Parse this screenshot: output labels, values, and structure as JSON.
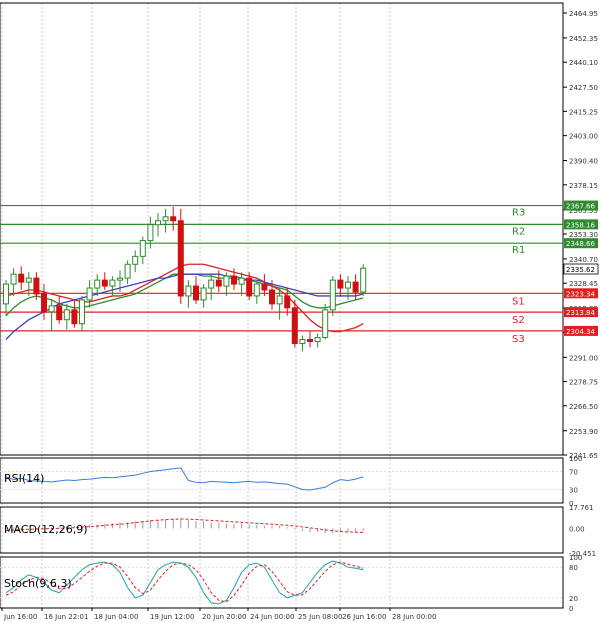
{
  "chart_data": [
    {
      "type": "candlestick",
      "pane": "price",
      "ylim": [
        2241.65,
        2470
      ],
      "y_ticks": [
        "2464.95",
        "2452.35",
        "2440.10",
        "2427.50",
        "2415.25",
        "2403.00",
        "2390.40",
        "2378.15",
        "2365.55",
        "2353.30",
        "2340.70",
        "2328.45",
        "2315.85",
        "2303.60",
        "2291.00",
        "2278.75",
        "2266.50",
        "2253.90",
        "2241.65"
      ],
      "x_ticks": [
        "Jun 16:00",
        "16 Jun 22:01",
        "18 Jun 04:00",
        "19 Jun 12:00",
        "20 Jun 20:00",
        "24 Jun 00:00",
        "25 Jun 08:00",
        "26 Jun 16:00",
        "28 Jun 00:00"
      ],
      "last_price": "2335.62",
      "candles": [
        [
          2318,
          2330,
          2312,
          2328
        ],
        [
          2328,
          2336,
          2322,
          2333
        ],
        [
          2333,
          2337,
          2325,
          2329
        ],
        [
          2329,
          2334,
          2322,
          2331
        ],
        [
          2331,
          2334,
          2320,
          2323
        ],
        [
          2323,
          2328,
          2310,
          2314
        ],
        [
          2314,
          2320,
          2304,
          2317
        ],
        [
          2317,
          2322,
          2308,
          2310
        ],
        [
          2310,
          2318,
          2305,
          2315
        ],
        [
          2315,
          2320,
          2306,
          2308
        ],
        [
          2308,
          2322,
          2304,
          2320
        ],
        [
          2320,
          2330,
          2316,
          2326
        ],
        [
          2326,
          2333,
          2322,
          2330
        ],
        [
          2330,
          2334,
          2325,
          2327
        ],
        [
          2327,
          2332,
          2322,
          2330
        ],
        [
          2330,
          2335,
          2324,
          2331
        ],
        [
          2331,
          2340,
          2328,
          2338
        ],
        [
          2338,
          2345,
          2334,
          2342
        ],
        [
          2342,
          2352,
          2338,
          2350
        ],
        [
          2350,
          2362,
          2346,
          2358
        ],
        [
          2358,
          2364,
          2352,
          2360
        ],
        [
          2360,
          2366,
          2354,
          2362
        ],
        [
          2362,
          2367,
          2355,
          2360
        ],
        [
          2360,
          2366,
          2318,
          2322
        ],
        [
          2322,
          2330,
          2316,
          2327
        ],
        [
          2327,
          2332,
          2318,
          2320
        ],
        [
          2320,
          2328,
          2316,
          2326
        ],
        [
          2326,
          2333,
          2320,
          2330
        ],
        [
          2330,
          2335,
          2324,
          2327
        ],
        [
          2327,
          2334,
          2322,
          2332
        ],
        [
          2332,
          2336,
          2325,
          2328
        ],
        [
          2328,
          2334,
          2322,
          2331
        ],
        [
          2331,
          2334,
          2320,
          2322
        ],
        [
          2322,
          2330,
          2318,
          2328
        ],
        [
          2328,
          2333,
          2322,
          2325
        ],
        [
          2325,
          2330,
          2315,
          2318
        ],
        [
          2318,
          2326,
          2310,
          2322
        ],
        [
          2322,
          2326,
          2312,
          2316
        ],
        [
          2316,
          2320,
          2296,
          2298
        ],
        [
          2298,
          2302,
          2294,
          2300
        ],
        [
          2300,
          2304,
          2296,
          2299
        ],
        [
          2299,
          2303,
          2296,
          2301
        ],
        [
          2301,
          2318,
          2300,
          2315
        ],
        [
          2315,
          2332,
          2312,
          2330
        ],
        [
          2330,
          2333,
          2322,
          2326
        ],
        [
          2326,
          2332,
          2320,
          2329
        ],
        [
          2329,
          2333,
          2320,
          2324
        ],
        [
          2324,
          2338,
          2322,
          2336
        ]
      ],
      "series": [
        {
          "values": [
            2312,
            2316,
            2319,
            2321,
            2322,
            2321,
            2320,
            2318,
            2317,
            2316,
            2316,
            2317,
            2318,
            2319,
            2320,
            2321,
            2322,
            2323,
            2325,
            2327,
            2329,
            2331,
            2333,
            2333,
            2333,
            2333,
            2332,
            2332,
            2331,
            2331,
            2331,
            2330,
            2330,
            2329,
            2328,
            2327,
            2326,
            2325,
            2322,
            2319,
            2317,
            2316,
            2316,
            2317,
            2318,
            2319,
            2320,
            2321
          ]
        },
        {
          "values": [
            2322,
            2323,
            2324,
            2325,
            2325,
            2324,
            2323,
            2322,
            2321,
            2320,
            2319,
            2319,
            2320,
            2321,
            2322,
            2322,
            2323,
            2325,
            2327,
            2329,
            2331,
            2333,
            2335,
            2337,
            2338,
            2338,
            2338,
            2337,
            2336,
            2335,
            2334,
            2333,
            2332,
            2331,
            2329,
            2327,
            2325,
            2322,
            2318,
            2314,
            2310,
            2307,
            2305,
            2304,
            2304,
            2305,
            2306,
            2308
          ]
        },
        {
          "values": [
            2300,
            2304,
            2307,
            2310,
            2312,
            2314,
            2316,
            2318,
            2319,
            2320,
            2321,
            2322,
            2323,
            2324,
            2325,
            2326,
            2327,
            2328,
            2329,
            2330,
            2331,
            2331,
            2332,
            2333,
            2333,
            2333,
            2333,
            2333,
            2333,
            2332,
            2332,
            2331,
            2330,
            2330,
            2329,
            2328,
            2327,
            2326,
            2325,
            2324,
            2323,
            2322,
            2322,
            2322,
            2322,
            2322,
            2322,
            2323
          ]
        }
      ],
      "levels": [
        {
          "label": "R3",
          "value": 2367.66,
          "tag": "2367.66",
          "color": "#2e8b2e"
        },
        {
          "label": "R2",
          "value": 2358.16,
          "tag": "2358.16",
          "color": "#2e8b2e"
        },
        {
          "label": "R1",
          "value": 2348.66,
          "tag": "2348.66",
          "color": "#2e8b2e"
        },
        {
          "label": "S1",
          "value": 2323.34,
          "tag": "2323.34",
          "color": "#e02020"
        },
        {
          "label": "S2",
          "value": 2313.84,
          "tag": "2313.84",
          "color": "#e02020"
        },
        {
          "label": "S3",
          "value": 2304.34,
          "tag": "2304.34",
          "color": "#e02020"
        }
      ]
    },
    {
      "type": "line",
      "pane": "rsi",
      "label": "RSI(14)",
      "ylim": [
        0,
        100
      ],
      "y_ticks": [
        "100",
        "70",
        "30",
        "0"
      ],
      "series": [
        {
          "values": [
            58,
            52,
            55,
            50,
            49,
            48,
            47,
            49,
            51,
            50,
            52,
            53,
            55,
            57,
            56,
            58,
            60,
            62,
            66,
            70,
            72,
            74,
            76,
            78,
            50,
            46,
            45,
            48,
            47,
            46,
            45,
            47,
            48,
            46,
            47,
            45,
            43,
            42,
            36,
            30,
            29,
            32,
            35,
            45,
            52,
            50,
            53,
            58
          ]
        }
      ]
    },
    {
      "type": "line",
      "pane": "macd",
      "label": "MACD(12,26,9)",
      "ylim": [
        -20.451,
        17.761
      ],
      "y_ticks": [
        "17.761",
        "0.00",
        "-20.451"
      ],
      "series": [
        {
          "values": [
            -2.0,
            -1.5,
            -1.0,
            -0.8,
            -0.5,
            -0.3,
            -0.2,
            0.0,
            0.3,
            0.6,
            1.0,
            1.5,
            2.0,
            2.5,
            3.0,
            3.5,
            4.0,
            4.8,
            5.5,
            6.2,
            6.8,
            7.3,
            7.6,
            7.8,
            7.7,
            7.4,
            7.0,
            6.6,
            6.2,
            5.8,
            5.4,
            5.0,
            4.6,
            4.2,
            3.8,
            3.4,
            3.0,
            2.6,
            2.0,
            1.2,
            0.4,
            -0.4,
            -1.2,
            -2.0,
            -2.6,
            -3.0,
            -3.2,
            -3.3
          ]
        }
      ],
      "histogram": [
        -1,
        -1,
        -1,
        0,
        0,
        0,
        1,
        1,
        2,
        2,
        3,
        3,
        3,
        4,
        4,
        5,
        5,
        6,
        6,
        7,
        7,
        7,
        8,
        8,
        7,
        6,
        6,
        5,
        5,
        4,
        4,
        4,
        3,
        3,
        2,
        2,
        2,
        1,
        -1,
        -2,
        -3,
        -3,
        -4,
        -4,
        -3,
        -3,
        -3,
        -2
      ]
    },
    {
      "type": "line",
      "pane": "stoch",
      "label": "Stoch(9,6,3)",
      "ylim": [
        0,
        100
      ],
      "y_ticks": [
        "100",
        "80",
        "20",
        "0"
      ],
      "series": [
        {
          "values": [
            30,
            40,
            55,
            65,
            60,
            50,
            35,
            30,
            45,
            60,
            75,
            85,
            88,
            90,
            85,
            70,
            40,
            20,
            25,
            50,
            75,
            85,
            90,
            88,
            80,
            60,
            30,
            10,
            8,
            15,
            40,
            70,
            85,
            88,
            80,
            55,
            30,
            20,
            25,
            30,
            50,
            70,
            85,
            92,
            88,
            80,
            78,
            75
          ]
        },
        {
          "values": [
            25,
            32,
            45,
            55,
            60,
            58,
            48,
            38,
            38,
            48,
            60,
            72,
            82,
            88,
            88,
            80,
            62,
            40,
            28,
            35,
            55,
            72,
            85,
            88,
            85,
            75,
            55,
            30,
            15,
            12,
            25,
            45,
            68,
            82,
            85,
            72,
            52,
            32,
            25,
            26,
            38,
            55,
            72,
            85,
            90,
            86,
            82,
            78
          ]
        }
      ]
    }
  ]
}
